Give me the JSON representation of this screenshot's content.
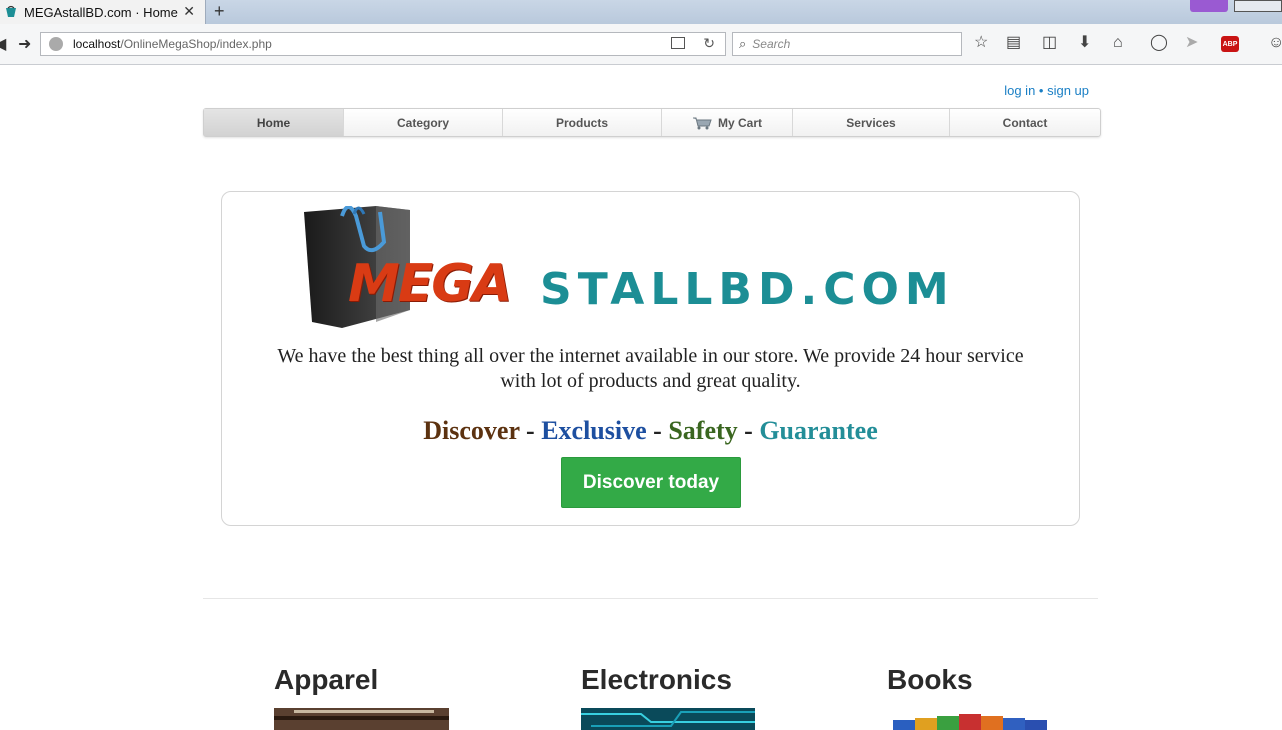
{
  "browser": {
    "tab_title": "MEGAstallBD.com · Home",
    "tab_close": "✕",
    "new_tab": "+",
    "url_host": "localhost",
    "url_path": "/OnlineMegaShop/index.php",
    "search_placeholder": "Search"
  },
  "header": {
    "login_label": "log in",
    "separator": " • ",
    "signup_label": "sign up"
  },
  "menu": {
    "items": [
      {
        "label": "Home"
      },
      {
        "label": "Category"
      },
      {
        "label": "Products"
      },
      {
        "label": "My Cart"
      },
      {
        "label": "Services"
      },
      {
        "label": "Contact"
      }
    ]
  },
  "hero": {
    "logo_mega": "MEGA",
    "logo_rest": "STALLBD.COM",
    "description": "We have the best thing all over the internet available in our store. We provide 24 hour service with lot of products and great quality.",
    "slogan": {
      "discover": "Discover",
      "exclusive": "Exclusive",
      "safety": "Safety",
      "guarantee": "Guarantee",
      "dash": " - "
    },
    "cta_label": "Discover today"
  },
  "categories": [
    {
      "title": "Apparel"
    },
    {
      "title": "Electronics"
    },
    {
      "title": "Books"
    }
  ],
  "colors": {
    "link": "#1a7fc5",
    "cta": "#33aa47",
    "logo_red": "#d93b14",
    "logo_teal": "#1c8e95"
  }
}
